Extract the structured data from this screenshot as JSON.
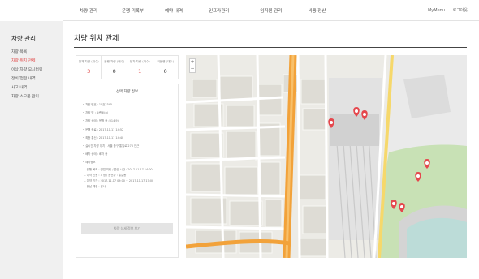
{
  "nav": {
    "items": [
      "차량 관리",
      "운행 기록부",
      "예약 내역",
      "인프라관리",
      "임직원 관리",
      "비용 정산"
    ],
    "util": [
      "MyMenu",
      "로그아웃"
    ]
  },
  "sidebar": {
    "title": "차량 관리",
    "items": [
      {
        "label": "차량 목록",
        "active": false
      },
      {
        "label": "차량 위치 관제",
        "active": true
      },
      {
        "label": "이상 차량 모니터링",
        "active": false
      },
      {
        "label": "정비/점검 내역",
        "active": false
      },
      {
        "label": "사고 내역",
        "active": false
      },
      {
        "label": "차량 소모품 관리",
        "active": false
      }
    ]
  },
  "page": {
    "title": "차량 위치 관제"
  },
  "stats": [
    {
      "label": "전체 차량 (대수)",
      "value": "3",
      "red": true
    },
    {
      "label": "운행 차량 (대수)",
      "value": "0",
      "red": false
    },
    {
      "label": "정차 차량 (대수)",
      "value": "1",
      "red": true
    },
    {
      "label": "미운행 (대수)",
      "value": "0",
      "red": false
    }
  ],
  "detail": {
    "title": "선택 차량 정보",
    "lines": [
      "• 차량 번호 : 11호2345",
      "• 차량 명 : 쏘렌토(g)",
      "• 차량 상태 : 운행 중 (01:49)",
      "• 운행 종료 : 2017.11.17  14:52",
      "• 최종 통신 : 2017.11.17  14:40",
      "• 실시간 차량 위치 : 서울 중구 통일로 276 인근",
      "• 배차 상태 : 배차 중"
    ],
    "reservation_title": "• 예약정보",
    "reservation_lines": [
      "– 운행 목적 : 영업 미팅 / 출발 시간 : 2017.11.17 14:00",
      "– 예약 인원 : 3 명 / 운전자 : 홍길동",
      "– 예약 기간 : 2017.11.17 09:00 ~ 2017.11.17 17:00",
      "– 반납 예정 : 본사"
    ],
    "button": "차량 상세 정보 보기"
  },
  "map": {
    "zoom_in": "+",
    "zoom_out": "−",
    "colors": {
      "road_main": "#f2a23a",
      "marker": "#e5474d",
      "park": "#c8e1b5",
      "rail": "#d6d6d6"
    }
  }
}
